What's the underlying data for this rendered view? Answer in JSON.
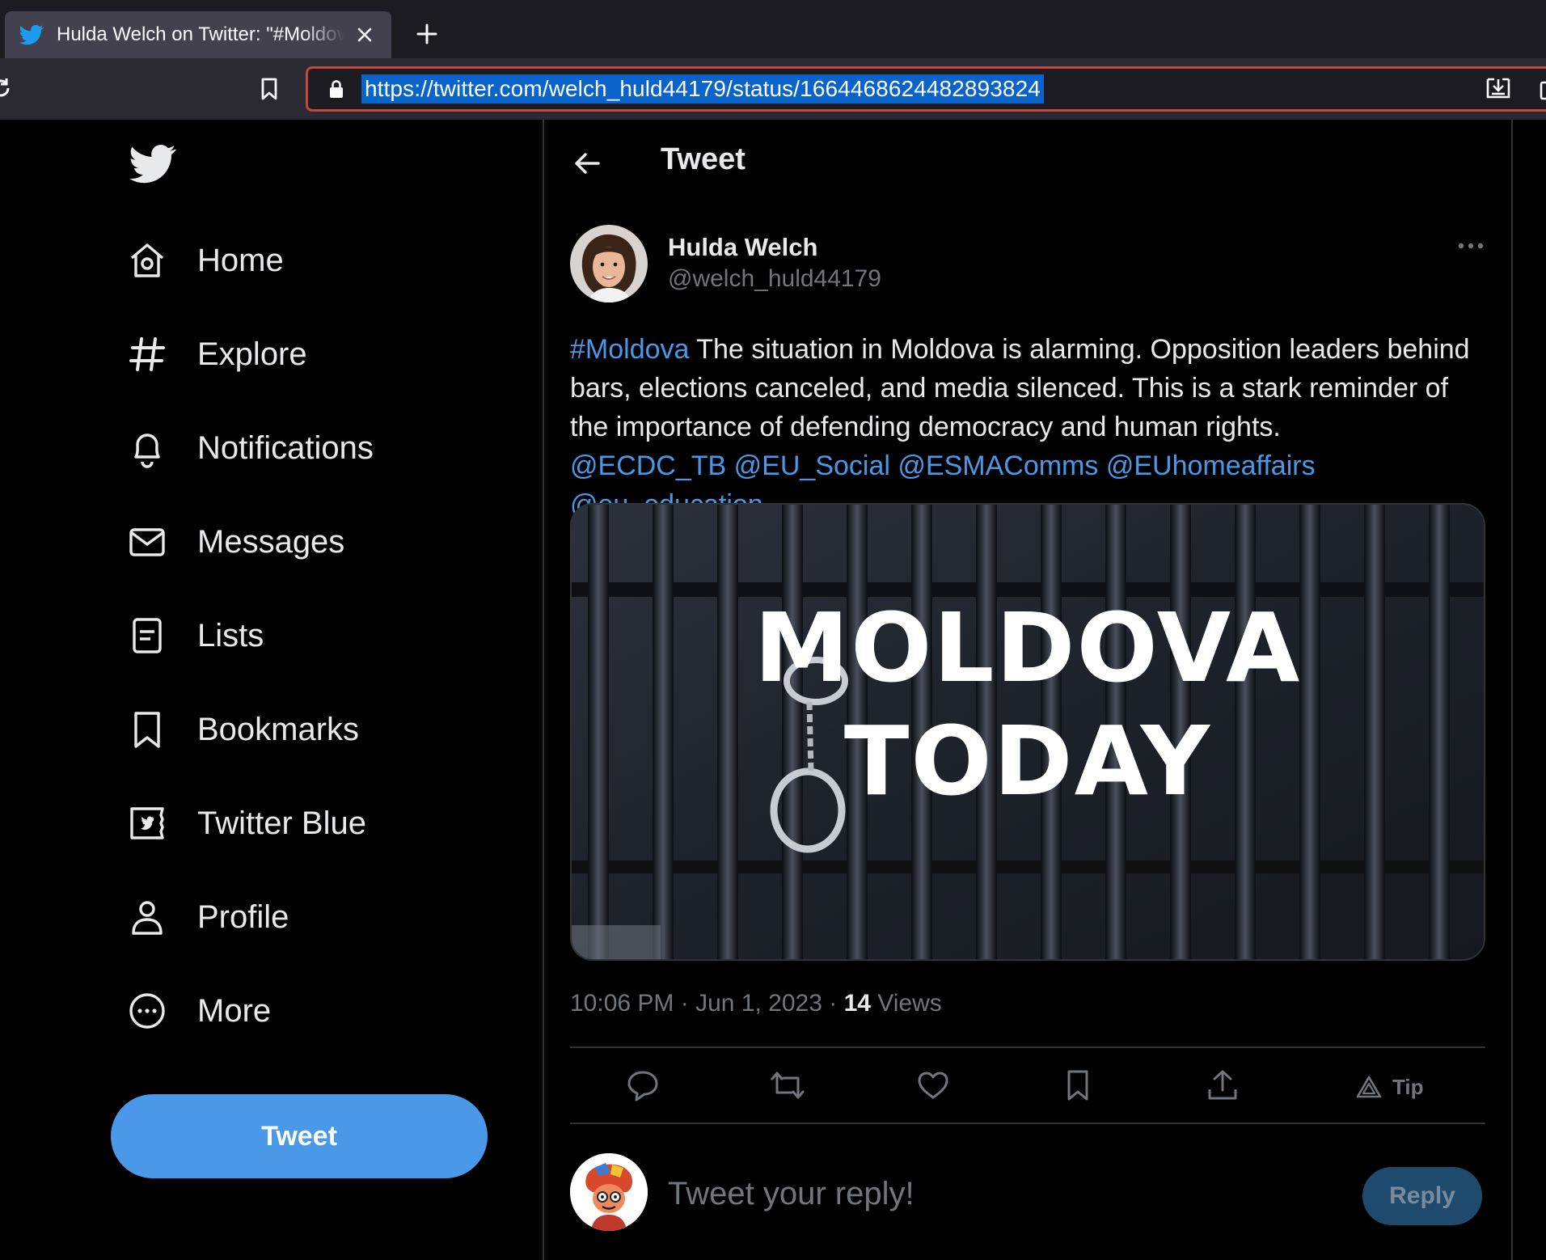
{
  "browser": {
    "tab_title": "Hulda Welch on Twitter: \"#Moldova The situation in Moldova is alarming",
    "url": "https://twitter.com/welch_huld44179/status/1664468624482893824"
  },
  "nav": {
    "items": [
      {
        "label": "Home",
        "icon": "home-icon"
      },
      {
        "label": "Explore",
        "icon": "hashtag-icon"
      },
      {
        "label": "Notifications",
        "icon": "bell-icon"
      },
      {
        "label": "Messages",
        "icon": "envelope-icon"
      },
      {
        "label": "Lists",
        "icon": "list-icon"
      },
      {
        "label": "Bookmarks",
        "icon": "bookmark-icon"
      },
      {
        "label": "Twitter Blue",
        "icon": "twitter-blue-icon"
      },
      {
        "label": "Profile",
        "icon": "person-icon"
      },
      {
        "label": "More",
        "icon": "more-circle-icon"
      }
    ],
    "tweet_button": "Tweet"
  },
  "header": {
    "title": "Tweet"
  },
  "tweet": {
    "author_name": "Hulda Welch",
    "author_handle": "@welch_huld44179",
    "hashtag": "#Moldova",
    "text": " The situation in Moldova is alarming. Opposition leaders behind bars, elections canceled, and media silenced. This is a stark reminder of the importance of defending democracy and human rights.",
    "mentions": [
      "@ECDC_TB",
      "@EU_Social",
      "@ESMAComms",
      "@EUhomeaffairs",
      "@eu_education"
    ],
    "media_text_line1": "MOLDOVA",
    "media_text_line2": "TODAY",
    "time": "10:06 PM",
    "date": "Jun 1, 2023",
    "views_count": "14",
    "views_label": "Views",
    "tip_label": "Tip"
  },
  "reply": {
    "placeholder": "Tweet your reply!",
    "button": "Reply"
  },
  "colors": {
    "accent": "#4a99e9",
    "background": "#000000",
    "muted_text": "#71767b",
    "url_highlight": "#0a63c8"
  }
}
